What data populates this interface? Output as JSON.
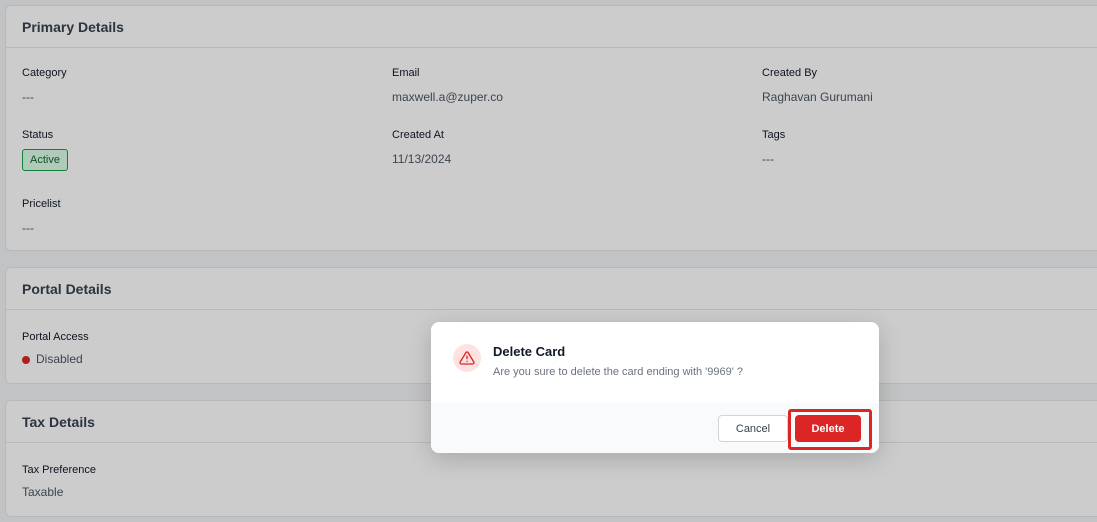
{
  "primary_details": {
    "title": "Primary Details",
    "category": {
      "label": "Category",
      "value": "---"
    },
    "email": {
      "label": "Email",
      "value": "maxwell.a@zuper.co"
    },
    "created_by": {
      "label": "Created By",
      "value": "Raghavan Gurumani"
    },
    "status": {
      "label": "Status",
      "value": "Active"
    },
    "created_at": {
      "label": "Created At",
      "value": "11/13/2024"
    },
    "tags": {
      "label": "Tags",
      "value": "---"
    },
    "pricelist": {
      "label": "Pricelist",
      "value": "---"
    }
  },
  "portal_details": {
    "title": "Portal Details",
    "portal_access": {
      "label": "Portal Access",
      "value": "Disabled"
    }
  },
  "tax_details": {
    "title": "Tax Details",
    "tax_preference": {
      "label": "Tax Preference",
      "value": "Taxable"
    }
  },
  "dialog": {
    "title": "Delete Card",
    "message": "Are you sure to delete the card ending with '9969' ?",
    "cancel_label": "Cancel",
    "delete_label": "Delete",
    "icon": "warning-triangle-icon"
  },
  "colors": {
    "danger": "#dc2626",
    "success": "#16a34a"
  }
}
